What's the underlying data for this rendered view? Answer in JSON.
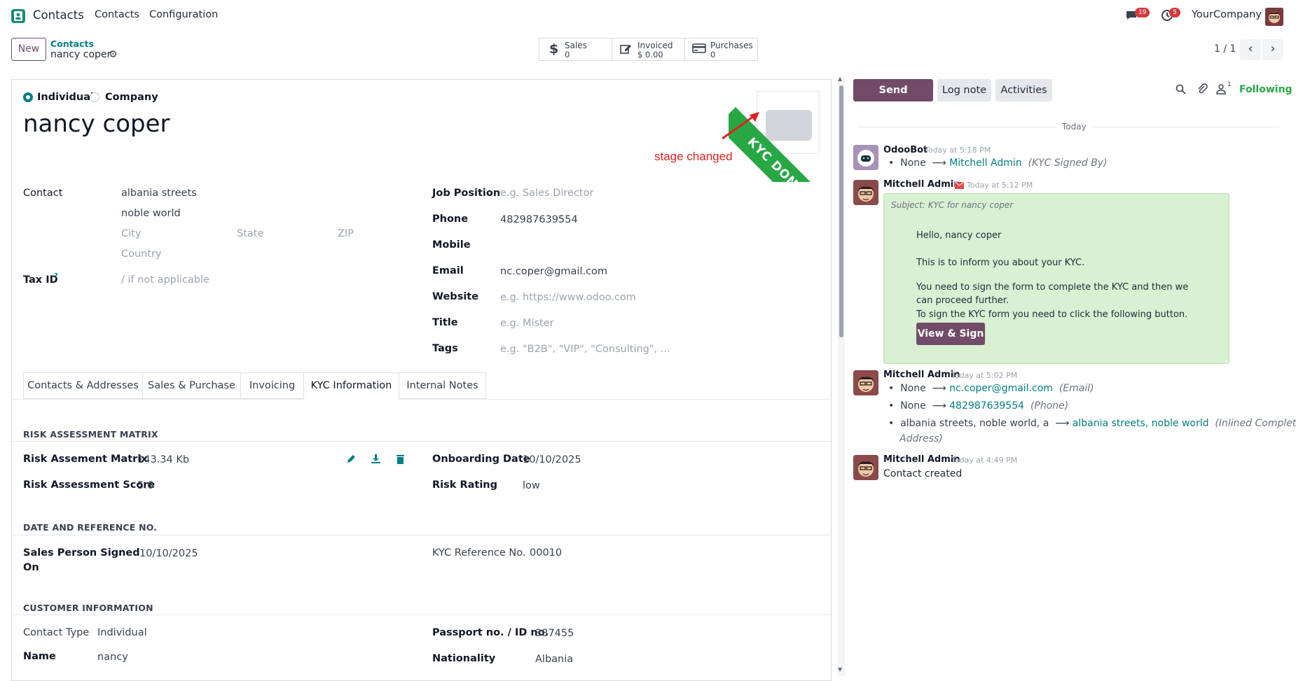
{
  "topbar": {
    "app_name": "Contacts",
    "menu": [
      "Contacts",
      "Configuration"
    ],
    "chat_badge": "19",
    "activity_badge": "5",
    "company": "YourCompany"
  },
  "control": {
    "new_label": "New",
    "breadcrumb_parent": "Contacts",
    "breadcrumb_current": "nancy coper",
    "smart_buttons": [
      {
        "label": "Sales",
        "value": "0"
      },
      {
        "label": "Invoiced",
        "value": "$ 0.00"
      },
      {
        "label": "Purchases",
        "value": "0"
      }
    ],
    "pager": "1 / 1"
  },
  "form": {
    "type_options": [
      "Individual",
      "Company"
    ],
    "name": "nancy coper",
    "ribbon": "KYC DONE",
    "annotation": "stage changed",
    "contact_label": "Contact",
    "street": "albania streets",
    "street2": "noble world",
    "city_ph": "City",
    "state_ph": "State",
    "zip_ph": "ZIP",
    "country_ph": "Country",
    "tax_label": "Tax ID",
    "tax_help": "?",
    "tax_ph": "/ if not applicable",
    "job_label": "Job Position",
    "job_ph": "e.g. Sales Director",
    "phone_label": "Phone",
    "phone": "482987639554",
    "mobile_label": "Mobile",
    "email_label": "Email",
    "email": "nc.coper@gmail.com",
    "website_label": "Website",
    "website_ph": "e.g. https://www.odoo.com",
    "title_label": "Title",
    "title_ph": "e.g. Mister",
    "tags_label": "Tags",
    "tags_ph": "e.g. \"B2B\", \"VIP\", \"Consulting\", ..."
  },
  "tabs": [
    "Contacts & Addresses",
    "Sales & Purchase",
    "Invoicing",
    "KYC Information",
    "Internal Notes"
  ],
  "kyc": {
    "sec_risk": "RISK ASSESSMENT MATRIX",
    "risk_matrix_label": "Risk Assement Matrix",
    "risk_matrix_value": "143.34 Kb",
    "risk_score_label": "Risk Assessment Score",
    "risk_score_value": "5.6",
    "onboarding_label": "Onboarding Date",
    "onboarding_value": "10/10/2025",
    "risk_rating_label": "Risk Rating",
    "risk_rating_value": "low",
    "sec_date": "DATE AND REFERENCE NO.",
    "signed_label_1": "Sales Person Signed",
    "signed_label_2": "On",
    "signed_value": "10/10/2025",
    "ref_label": "KYC Reference No.",
    "ref_value": "00010",
    "sec_customer": "CUSTOMER INFORMATION",
    "contact_type_label": "Contact Type",
    "contact_type_value": "Individual",
    "name_label": "Name",
    "name_value": "nancy",
    "passport_label": "Passport no. / ID no.",
    "passport_value": "387455",
    "nationality_label": "Nationality",
    "nationality_value": "Albania"
  },
  "chatter": {
    "send_message": "Send message",
    "log_note": "Log note",
    "activities": "Activities",
    "followers_count": "1",
    "following": "Following",
    "today": "Today",
    "m1": {
      "author": "OdooBot",
      "time": "Today at 5:18 PM",
      "old": "None",
      "new": "Mitchell Admin",
      "field": "(KYC Signed By)"
    },
    "m2": {
      "author": "Mitchell Admin",
      "time": "Today at 5:12 PM",
      "subject": "Subject: KYC for nancy coper",
      "greeting": "Hello, nancy coper",
      "p1": "This is to inform you about your KYC.",
      "p2a": "You need to sign the form to complete the KYC and then we",
      "p2b": "can proceed further.",
      "p3": "To sign the KYC form you need to click the following button.",
      "button": "View & Sign"
    },
    "m3": {
      "author": "Mitchell Admin",
      "time": "Today at 5:02 PM",
      "l1_old": "None",
      "l1_new": "nc.coper@gmail.com",
      "l1_field": "(Email)",
      "l2_old": "None",
      "l2_new": "482987639554",
      "l2_field": "(Phone)",
      "l3_old": "albania streets, noble world, a",
      "l3_new": "albania streets, noble world",
      "l3_field": "(Inlined Complete",
      "l3_field2": "Address)"
    },
    "m4": {
      "author": "Mitchell Admin",
      "time": "Today at 4:49 PM",
      "body": "Contact created"
    }
  },
  "colors": {
    "brand": "#714b67",
    "teal": "#017e84",
    "ribbon": "#28a745",
    "annotation": "#e02020",
    "note_bg": "#d9f0d3"
  }
}
